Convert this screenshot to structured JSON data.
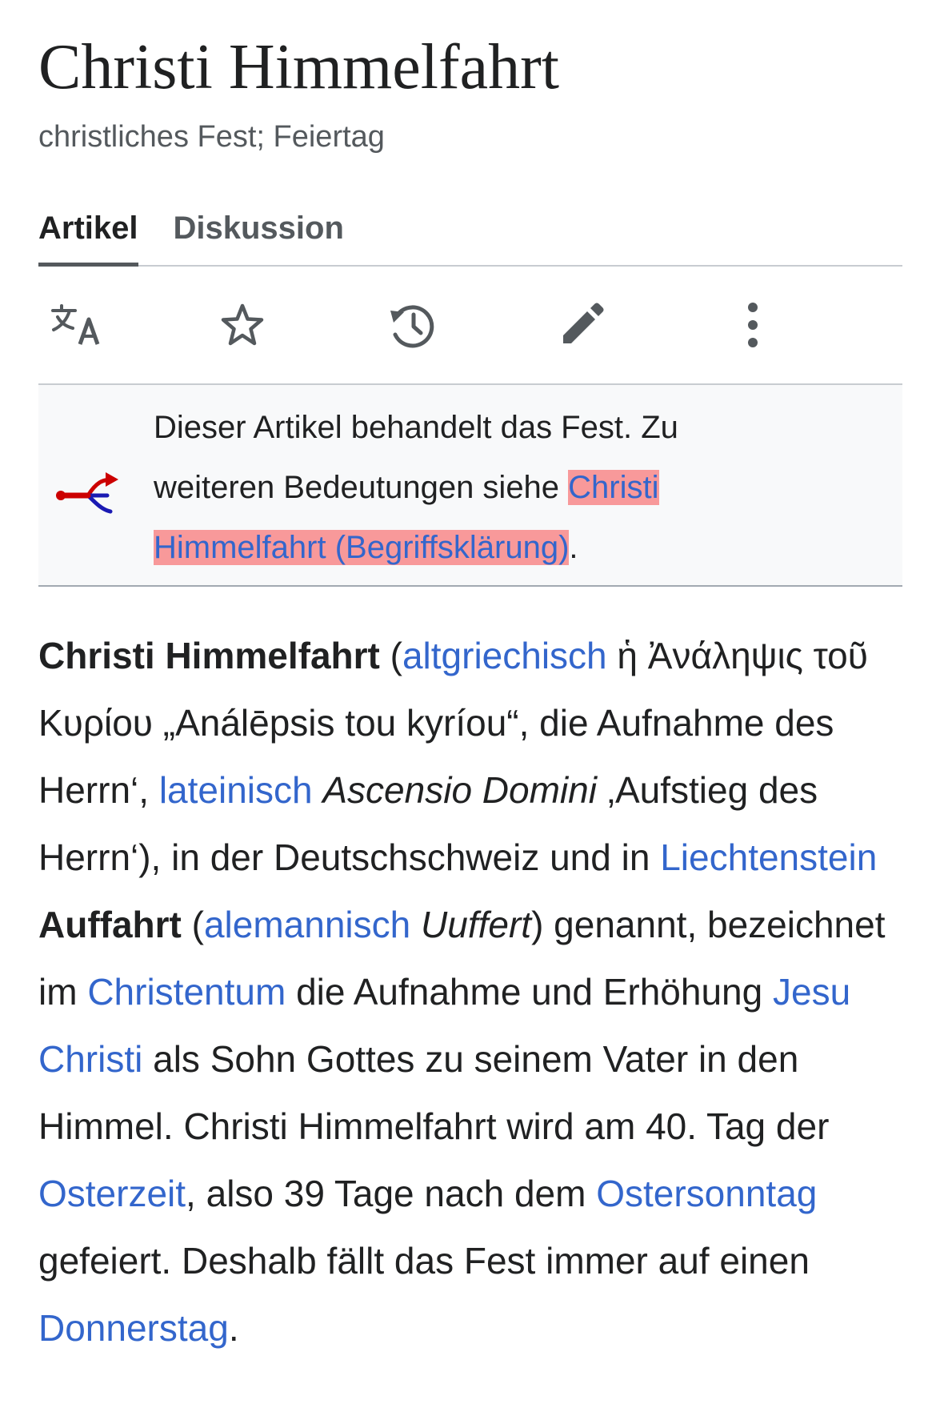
{
  "article": {
    "title": "Christi Himmelfahrt",
    "subtitle": "christliches Fest; Feiertag"
  },
  "tabs": [
    {
      "label": "Artikel",
      "active": true
    },
    {
      "label": "Diskussion",
      "active": false
    }
  ],
  "toolbar": {
    "icons": [
      "language-icon",
      "star-icon",
      "history-icon",
      "edit-pencil-icon",
      "more-vertical-icon"
    ]
  },
  "hatnote": {
    "text_before": "Dieser Artikel behandelt das Fest. Zu weiteren Bedeutungen siehe ",
    "link": "Christi Himmelfahrt (Begriffsklärung)",
    "text_after": "."
  },
  "lead": {
    "bold_title": "Christi Himmelfahrt",
    "t1": " (",
    "link_altgriechisch": "altgriechisch",
    "greek": " ἡ Ἀνάληψις τοῦ Κυρίου „Análēpsis tou kyríou“, die Aufnahme des Herrn‘, ",
    "link_lateinisch": "lateinisch",
    "t2": " ",
    "latin_italic": "Ascensio Domini",
    "t3": " ‚Aufstieg des Herrn‘), in der Deutschschweiz und in ",
    "link_liechtenstein": "Liechtenstein",
    "t4": " ",
    "bold_auffahrt": "Auffahrt",
    "t5": " (",
    "link_alemannisch": "alemannisch",
    "t6": " ",
    "uuffert_italic": "Uuffert",
    "t7": ") genannt, bezeichnet im ",
    "link_christentum": "Christentum",
    "t8": " die Aufnahme und Erhöhung ",
    "link_jesu_christi": "Jesu Christi",
    "t9": " als Sohn Gottes zu seinem Vater in den Himmel. Christi Himmelfahrt wird am 40. Tag der ",
    "link_osterzeit": "Osterzeit",
    "t10": ", also 39 Tage nach dem ",
    "link_ostersonntag": "Ostersonntag",
    "t11": " gefeiert. Deshalb fällt das Fest immer auf einen ",
    "link_donnerstag": "Donnerstag",
    "t12": "."
  },
  "colors": {
    "link": "#3366cc",
    "highlight": "#f8999a",
    "text": "#202122",
    "muted": "#54595d",
    "hatnote_bg": "#f8f9fa"
  }
}
